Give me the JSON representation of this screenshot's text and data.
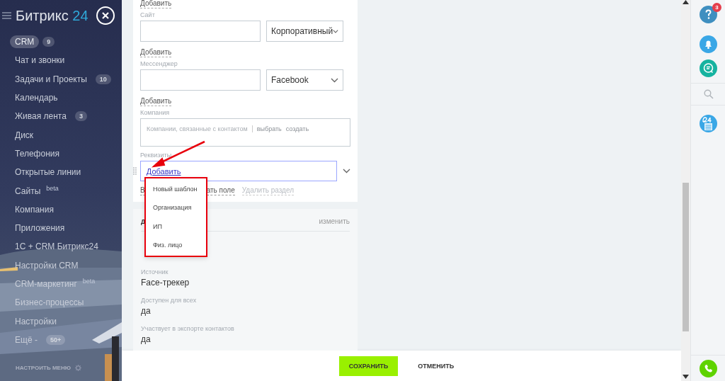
{
  "sidebar": {
    "logo": {
      "name": "Битрикс",
      "suffix": "24"
    },
    "items": [
      {
        "label": "CRM",
        "counter": "9",
        "selected": true
      },
      {
        "label": "Чат и звонки",
        "selected": false
      },
      {
        "label": "Задачи и Проекты",
        "counter": "10",
        "selected": false
      },
      {
        "label": "Календарь",
        "selected": false
      },
      {
        "label": "Живая лента",
        "counter": "3",
        "selected": false
      },
      {
        "label": "Диск",
        "selected": false
      },
      {
        "label": "Телефония",
        "selected": false
      },
      {
        "label": "Открытые линии",
        "selected": false
      },
      {
        "label": "Сайты",
        "tag": "beta",
        "selected": false
      },
      {
        "label": "Компания",
        "selected": false
      },
      {
        "label": "Приложения",
        "selected": false
      },
      {
        "label": "1С + CRM Битрикс24",
        "selected": false
      },
      {
        "label": "Настройки CRM",
        "selected": false
      },
      {
        "label": "CRM-маркетинг",
        "tag": "beta",
        "selected": false
      },
      {
        "label": "Бизнес-процессы",
        "selected": false
      },
      {
        "label": "Настройки",
        "selected": false
      },
      {
        "label": "Ещё -",
        "counter": "50+",
        "selected": false
      }
    ],
    "settings_label": "НАСТРОИТЬ МЕНЮ"
  },
  "form": {
    "top_add": "Добавить",
    "multi_fields": [
      {
        "label": "Сайт",
        "select": "Корпоративный",
        "add": "Добавить"
      },
      {
        "label": "Мессенджер",
        "select": "Facebook",
        "add": "Добавить"
      }
    ],
    "company": {
      "label": "Компания",
      "placeholder": "Компании, связанные с контактом",
      "actions": [
        "выбрать",
        "создать"
      ]
    },
    "requisites": {
      "label": "Реквизиты",
      "link": "Добавить"
    },
    "section_actions": [
      {
        "label": "В",
        "disabled": false
      },
      {
        "label": "ать поле",
        "disabled": false
      },
      {
        "label": "Удалить раздел",
        "disabled": true
      }
    ]
  },
  "dropdown": {
    "items": [
      "Новый шаблон",
      "Организация",
      "ИП",
      "Физ. лицо"
    ]
  },
  "details": {
    "title": "д",
    "action": "изменить",
    "fields": [
      {
        "label": "Источник",
        "value": "Face-трекер"
      },
      {
        "label": "Доступен для всех",
        "value": "да"
      },
      {
        "label": "Участвует в экспорте контактов",
        "value": "да"
      }
    ]
  },
  "footer": {
    "buttons": [
      {
        "label": "СОХРАНИТЬ",
        "kind": "primary"
      },
      {
        "label": "ОТМЕНИТЬ",
        "kind": "link"
      }
    ]
  },
  "right_panel": {
    "help_badge": "3"
  }
}
